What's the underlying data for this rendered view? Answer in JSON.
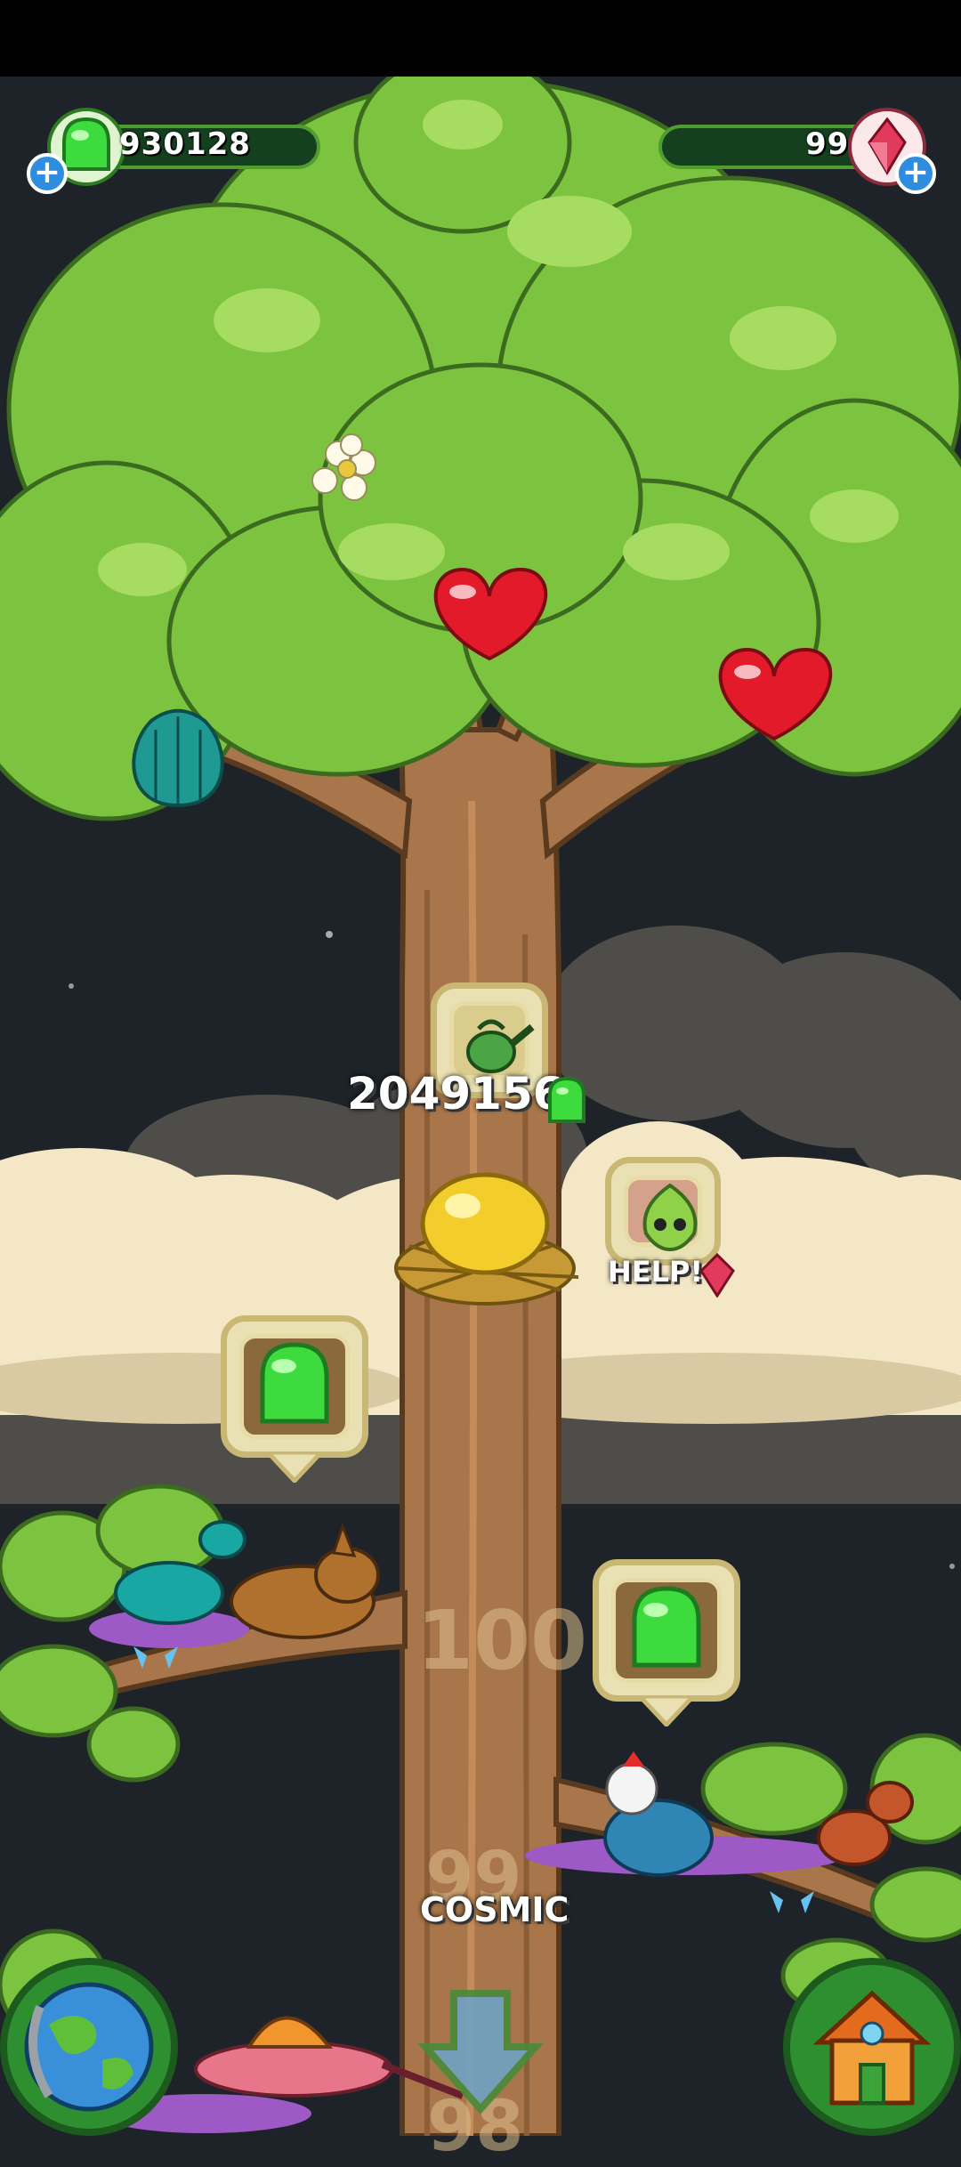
{
  "hud": {
    "jelly_count": "930128",
    "gem_count": "99"
  },
  "watering": {
    "amount": "2049156"
  },
  "helper": {
    "label": "HELP!"
  },
  "levels": {
    "level_100": "100",
    "level_99": "99",
    "level_99_name": "COSMIC",
    "level_98": "98"
  },
  "colors": {
    "leaf": "#7cc43f",
    "trunk": "#a8764a",
    "jelly": "#3ddb3d",
    "sky": "#1d2328"
  },
  "icons": [
    "jelly-icon",
    "gem-icon",
    "plus-icon",
    "watering-can-icon",
    "golden-egg-icon",
    "leaf-helper-icon",
    "globe-icon",
    "house-icon",
    "down-arrow-icon",
    "heart-fruit-icon",
    "shell-fruit-icon",
    "flower-icon"
  ]
}
